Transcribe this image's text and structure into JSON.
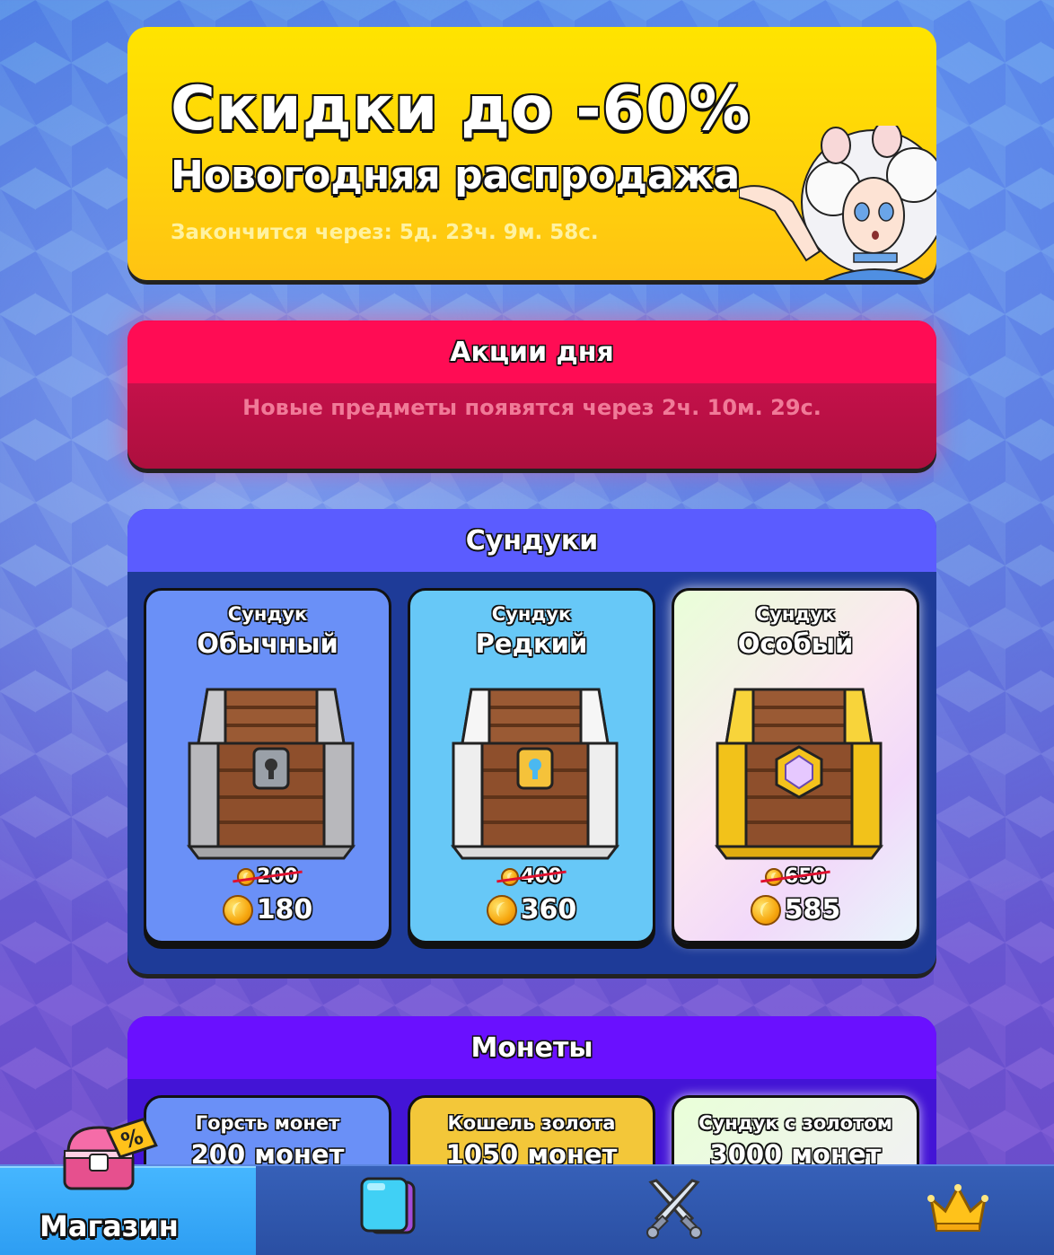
{
  "banner": {
    "title": "Скидки до -60%",
    "subtitle": "Новогодняя распродажа",
    "timer": "Закончится через: 5д. 23ч. 9м. 58с."
  },
  "daily": {
    "title": "Акции дня",
    "message": "Новые предметы появятся через 2ч. 10м. 29с."
  },
  "chests": {
    "title": "Сундуки",
    "items": [
      {
        "kind": "Сундук",
        "rarity": "Обычный",
        "old_price": "200",
        "price": "180"
      },
      {
        "kind": "Сундук",
        "rarity": "Редкий",
        "old_price": "400",
        "price": "360"
      },
      {
        "kind": "Сундук",
        "rarity": "Особый",
        "old_price": "650",
        "price": "585"
      }
    ]
  },
  "coins": {
    "title": "Монеты",
    "items": [
      {
        "name": "Горсть монет",
        "amount": "200 монет"
      },
      {
        "name": "Кошель золота",
        "amount": "1050 монет"
      },
      {
        "name": "Сундук с золотом",
        "amount": "3000 монет"
      }
    ]
  },
  "nav": {
    "items": [
      {
        "label": "Магазин",
        "icon": "shop-chest-icon",
        "active": true
      },
      {
        "label": "",
        "icon": "cards-icon"
      },
      {
        "label": "",
        "icon": "crossed-swords-icon"
      },
      {
        "label": "",
        "icon": "crown-icon"
      }
    ]
  },
  "colors": {
    "banner": "#ffd20a",
    "daily": "#ff0c54",
    "chests": "#5b5cff",
    "coins": "#6a10ff",
    "nav_active": "#2d9df2"
  }
}
